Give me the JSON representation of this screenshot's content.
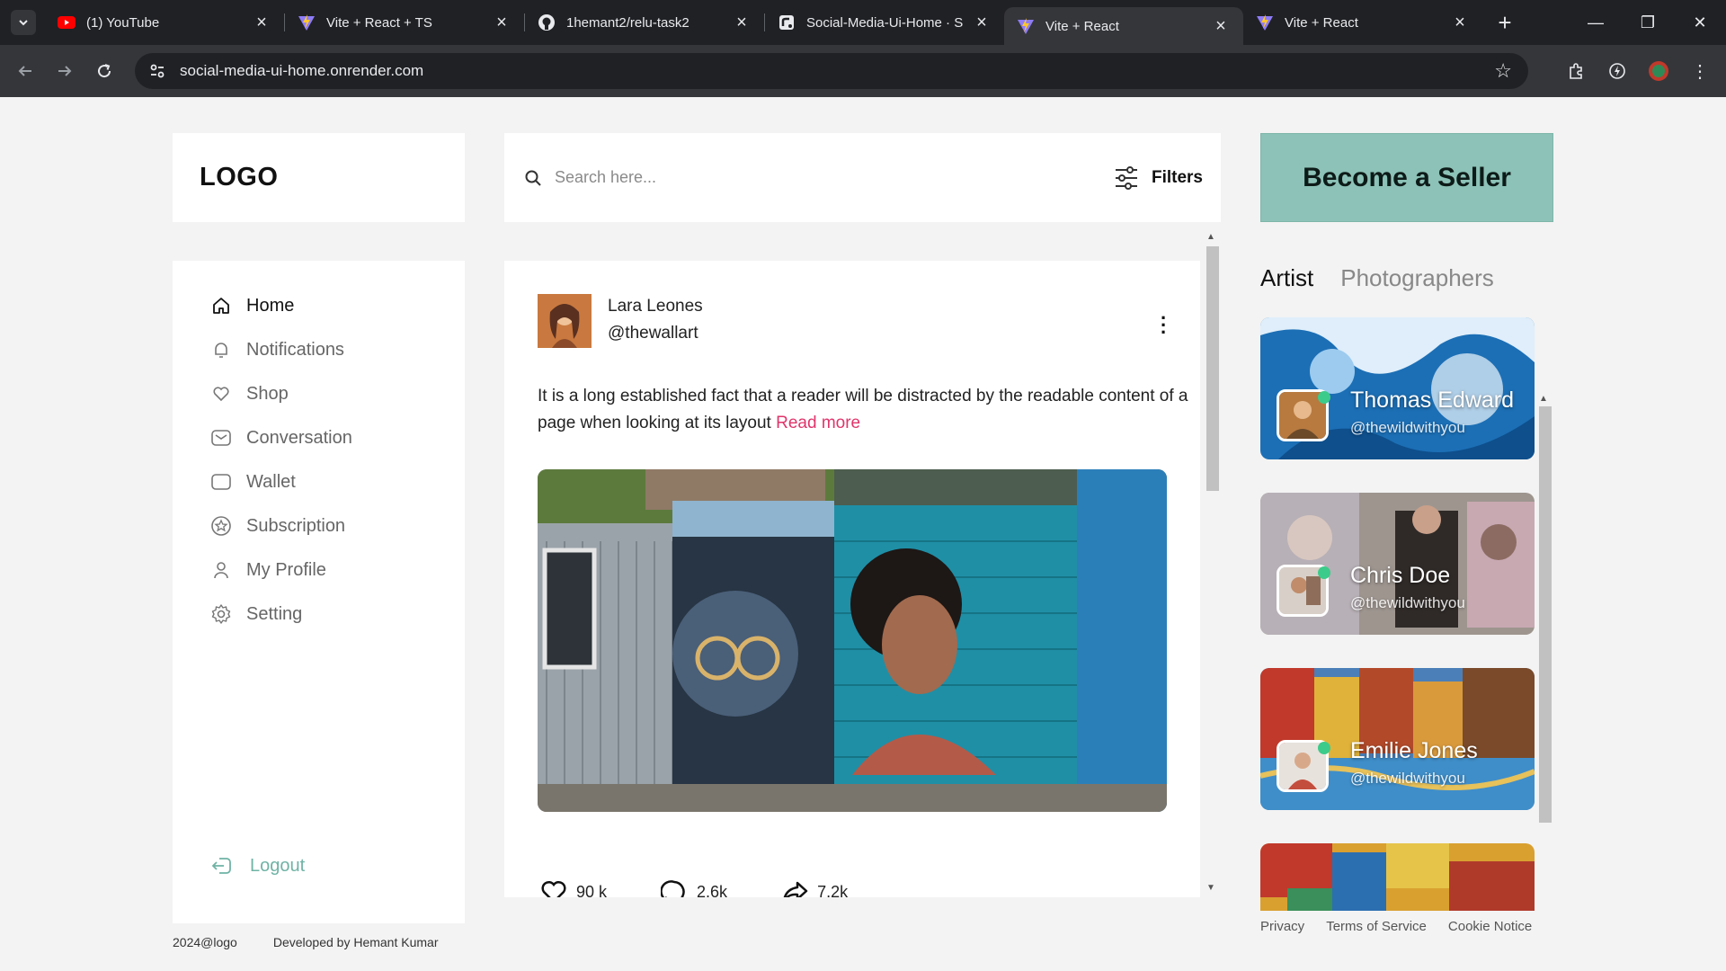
{
  "browser": {
    "tabs": [
      {
        "title": "(1) YouTube",
        "icon": "youtube-icon",
        "active": false
      },
      {
        "title": "Vite + React + TS",
        "icon": "vite-icon",
        "active": false
      },
      {
        "title": "1hemant2/relu-task2",
        "icon": "github-icon",
        "active": false
      },
      {
        "title": "Social-Media-Ui-Home · S",
        "icon": "render-icon",
        "active": false
      },
      {
        "title": "Vite + React",
        "icon": "vite-icon",
        "active": true
      },
      {
        "title": "Vite + React",
        "icon": "vite-icon",
        "active": false
      }
    ],
    "url": "social-media-ui-home.onrender.com"
  },
  "logo": "LOGO",
  "search": {
    "placeholder": "Search here...",
    "filters_label": "Filters"
  },
  "seller_button": "Become a Seller",
  "sidebar": {
    "items": [
      {
        "label": "Home",
        "icon": "home-icon",
        "active": true
      },
      {
        "label": "Notifications",
        "icon": "bell-icon",
        "active": false
      },
      {
        "label": "Shop",
        "icon": "heart-icon",
        "active": false
      },
      {
        "label": "Conversation",
        "icon": "mail-icon",
        "active": false
      },
      {
        "label": "Wallet",
        "icon": "wallet-icon",
        "active": false
      },
      {
        "label": "Subscription",
        "icon": "star-badge-icon",
        "active": false
      },
      {
        "label": "My Profile",
        "icon": "user-icon",
        "active": false
      },
      {
        "label": "Setting",
        "icon": "gear-icon",
        "active": false
      }
    ],
    "logout": "Logout"
  },
  "footer_left": {
    "copyright": "2024@logo",
    "credit": "Developed by Hemant Kumar"
  },
  "post": {
    "author_name": "Lara Leones",
    "author_handle": "@thewallart",
    "text": "It is a long established fact that a reader will be distracted by the readable content of a page when looking at its layout",
    "read_more": "Read more",
    "likes": "90 k",
    "comments": "2.6k",
    "shares": "7.2k"
  },
  "right_tabs": {
    "artist": "Artist",
    "photographers": "Photographers"
  },
  "artists": [
    {
      "name": "Thomas Edward",
      "handle": "@thewildwithyou"
    },
    {
      "name": "Chris Doe",
      "handle": "@thewildwithyou"
    },
    {
      "name": "Emilie Jones",
      "handle": "@thewildwithyou"
    },
    {
      "name": "",
      "handle": ""
    }
  ],
  "footer_right": {
    "privacy": "Privacy",
    "terms": "Terms of Service",
    "cookie": "Cookie Notice"
  },
  "colors": {
    "accent_teal": "#8cc2b7",
    "read_more": "#e0356b",
    "logout": "#6fb3a5",
    "online": "#3ccb8a"
  }
}
